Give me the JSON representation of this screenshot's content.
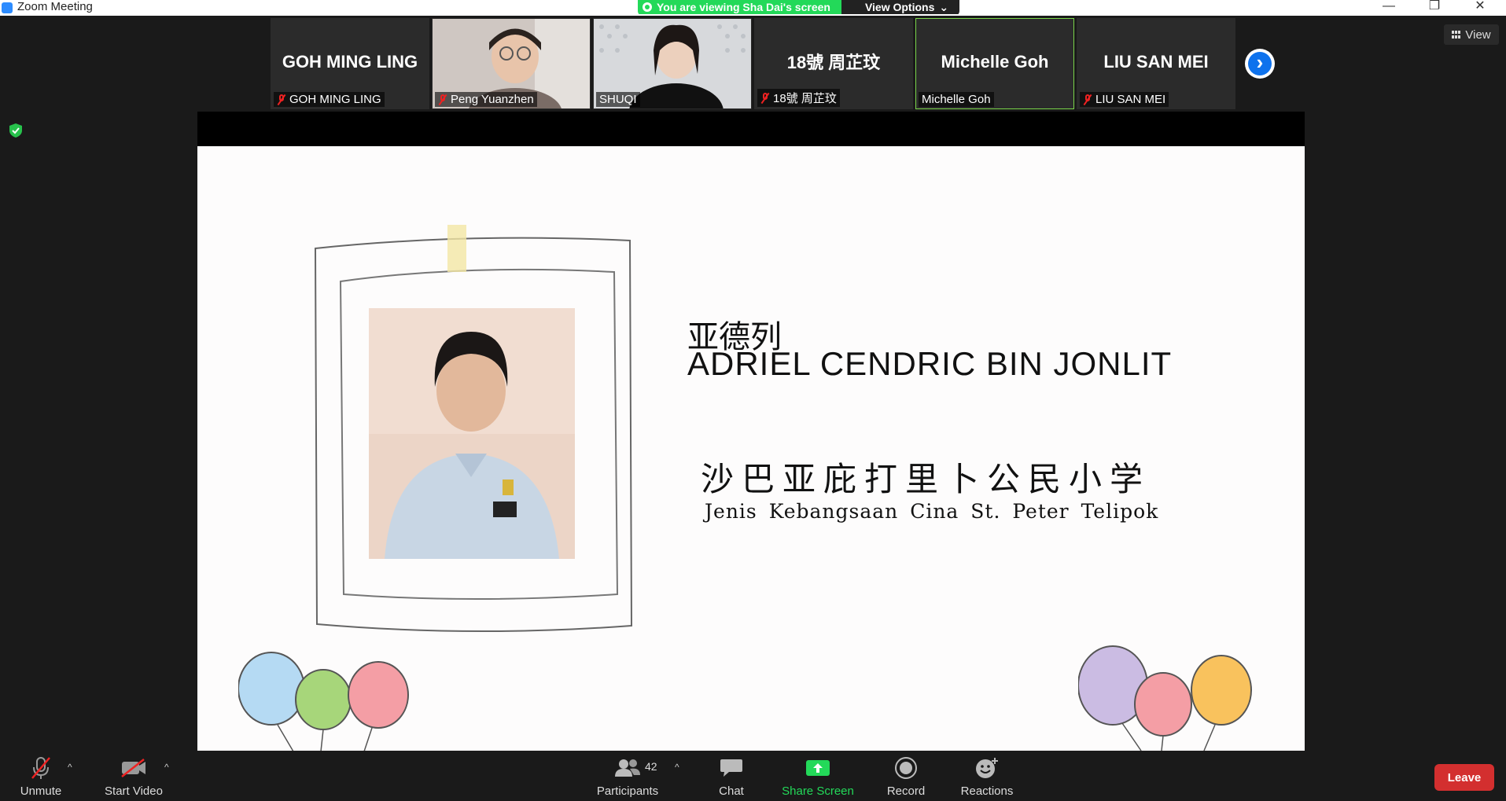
{
  "window": {
    "title": "Zoom Meeting",
    "controls": [
      "minimize-icon",
      "restore-icon",
      "close-icon"
    ]
  },
  "share_banner": {
    "text": "You are viewing Sha Dai's screen",
    "options_label": "View Options",
    "color": "#23d959"
  },
  "participants_strip": [
    {
      "display": "GOH MING LING",
      "label": "GOH MING LING",
      "muted": true,
      "video": false,
      "active": false
    },
    {
      "display": "",
      "label": "Peng Yuanzhen",
      "muted": true,
      "video": true,
      "active": false
    },
    {
      "display": "",
      "label": "SHUQI",
      "muted": false,
      "video": true,
      "active": false
    },
    {
      "display": "18號 周芷玟",
      "label": "18號 周芷玟",
      "muted": true,
      "video": false,
      "active": false
    },
    {
      "display": "Michelle Goh",
      "label": "Michelle Goh",
      "muted": false,
      "video": false,
      "active": true
    },
    {
      "display": "LIU SAN MEI",
      "label": "LIU SAN MEI",
      "muted": true,
      "video": false,
      "active": false
    }
  ],
  "view_button": {
    "label": "View"
  },
  "slide": {
    "student_name_cn": "亚德列",
    "student_name_en": "ADRIEL CENDRIC BIN JONLIT",
    "school_cn": "沙巴亚庇打里卜公民小学",
    "school_en": "Jenis Kebangsaan Cina St. Peter Telipok"
  },
  "toolbar": {
    "unmute_label": "Unmute",
    "video_label": "Start Video",
    "participants_label": "Participants",
    "participants_count": "42",
    "chat_label": "Chat",
    "share_label": "Share Screen",
    "record_label": "Record",
    "reactions_label": "Reactions",
    "leave_label": "Leave",
    "share_color": "#23d959",
    "leave_color": "#d32f2f"
  }
}
